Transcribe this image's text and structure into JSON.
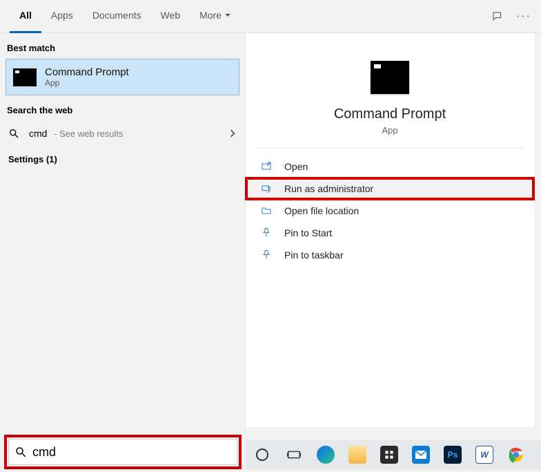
{
  "tabs": {
    "all": "All",
    "apps": "Apps",
    "documents": "Documents",
    "web": "Web",
    "more": "More"
  },
  "left": {
    "best_match_header": "Best match",
    "best_match": {
      "title": "Command Prompt",
      "subtitle": "App"
    },
    "search_web_header": "Search the web",
    "web_result": {
      "query": "cmd",
      "hint": " - See web results"
    },
    "settings_header": "Settings (1)"
  },
  "hero": {
    "title": "Command Prompt",
    "subtitle": "App"
  },
  "actions": {
    "open": "Open",
    "run_admin": "Run as administrator",
    "open_file_location": "Open file location",
    "pin_start": "Pin to Start",
    "pin_taskbar": "Pin to taskbar"
  },
  "search": {
    "value": "cmd"
  },
  "taskbar": {
    "items": [
      "cortana",
      "task-view",
      "edge",
      "file-explorer",
      "store",
      "mail",
      "photoshop",
      "word",
      "chrome"
    ]
  }
}
